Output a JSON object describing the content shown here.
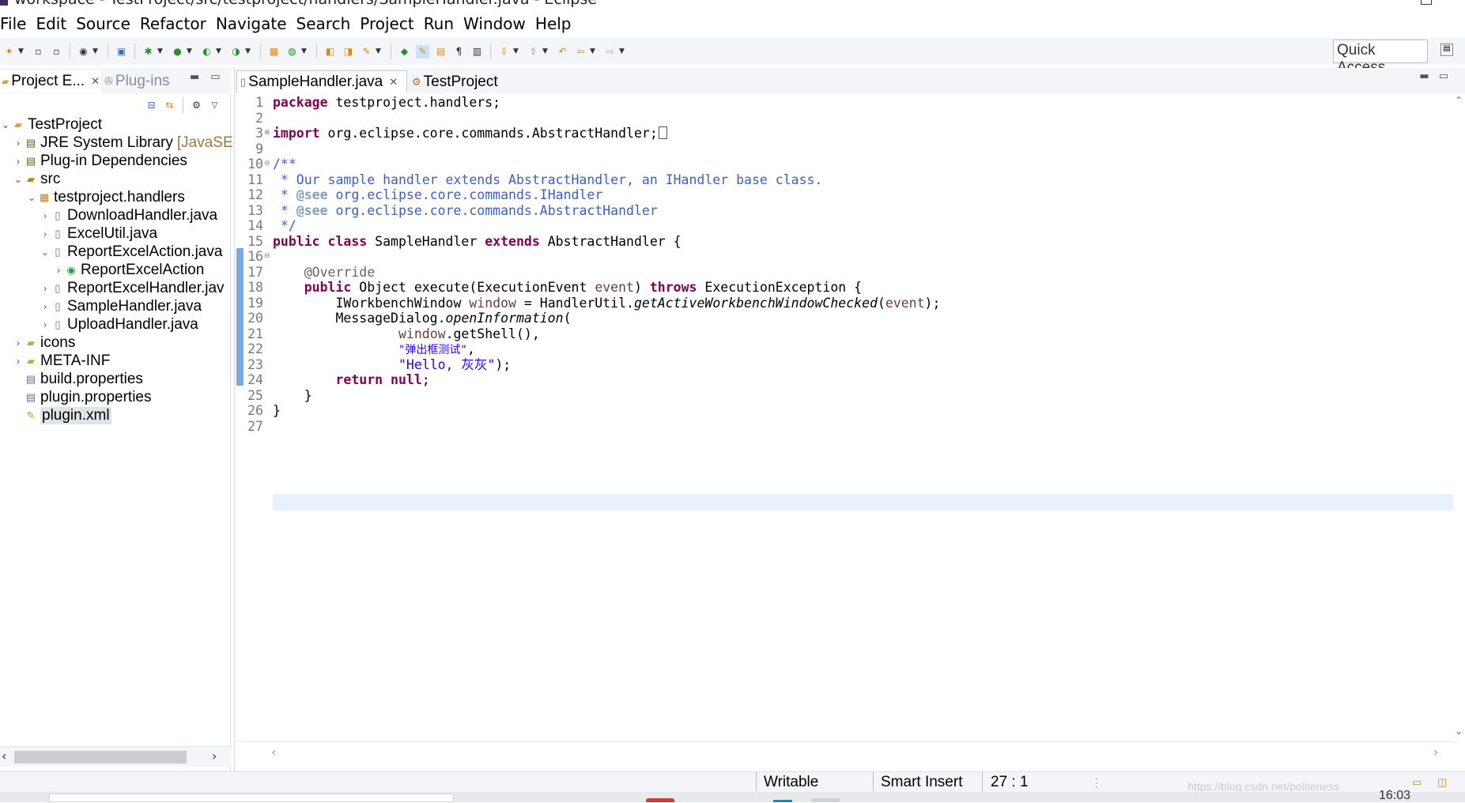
{
  "window": {
    "title": "workspace - TestProject/src/testproject/handlers/SampleHandler.java - Eclipse"
  },
  "menu": {
    "items": [
      "File",
      "Edit",
      "Source",
      "Refactor",
      "Navigate",
      "Search",
      "Project",
      "Run",
      "Window",
      "Help"
    ]
  },
  "toolbar": {
    "quick_access": "Quick Access"
  },
  "left_panel": {
    "tabs": [
      {
        "label": "Project E..."
      },
      {
        "label": "Plug-ins"
      }
    ],
    "tree": [
      {
        "label": "TestProject",
        "icon": "project-icon",
        "expanded": true
      },
      {
        "label": "JRE System Library",
        "decoration": "[JavaSE-",
        "icon": "library-icon"
      },
      {
        "label": "Plug-in Dependencies",
        "icon": "library-icon"
      },
      {
        "label": "src",
        "icon": "source-folder-icon",
        "expanded": true
      },
      {
        "label": "testproject.handlers",
        "icon": "package-icon",
        "expanded": true
      },
      {
        "label": "DownloadHandler.java",
        "icon": "java-file-icon"
      },
      {
        "label": "ExcelUtil.java",
        "icon": "java-file-icon"
      },
      {
        "label": "ReportExcelAction.java",
        "icon": "java-file-icon",
        "expanded": true
      },
      {
        "label": "ReportExcelAction",
        "icon": "class-icon"
      },
      {
        "label": "ReportExcelHandler.jav",
        "icon": "java-file-icon"
      },
      {
        "label": "SampleHandler.java",
        "icon": "java-file-icon"
      },
      {
        "label": "UploadHandler.java",
        "icon": "java-file-icon"
      },
      {
        "label": "icons",
        "icon": "folder-icon"
      },
      {
        "label": "META-INF",
        "icon": "folder-icon"
      },
      {
        "label": "build.properties",
        "icon": "properties-file-icon"
      },
      {
        "label": "plugin.properties",
        "icon": "properties-file-icon"
      },
      {
        "label": "plugin.xml",
        "icon": "xml-file-icon",
        "selected": true
      }
    ]
  },
  "editor": {
    "tabs": [
      {
        "label": "SampleHandler.java",
        "active": true
      },
      {
        "label": "TestProject"
      }
    ],
    "line_numbers": [
      "1",
      "2",
      "3",
      "9",
      "10",
      "11",
      "12",
      "13",
      "14",
      "15",
      "16",
      "17",
      "18",
      "19",
      "20",
      "21",
      "22",
      "23",
      "24",
      "25",
      "26",
      "27"
    ],
    "lines": {
      "l1_kw": "package",
      "l1_rest": " testproject.handlers;",
      "l3_kw": "import",
      "l3_rest": " org.eclipse.core.commands.AbstractHandler;",
      "l10": "/**",
      "l11": " * Our sample handler extends AbstractHandler, an IHandler base class.",
      "l12_a": " * ",
      "l12_tag": "@see",
      "l12_b": " org.eclipse.core.commands.IHandler",
      "l13_a": " * ",
      "l13_tag": "@see",
      "l13_b": " org.eclipse.core.commands.AbstractHandler",
      "l14": " */",
      "l15_kw1": "public",
      "l15_kw2": "class",
      "l15_name": " SampleHandler ",
      "l15_kw3": "extends",
      "l15_rest": " AbstractHandler {",
      "l17": "    @Override",
      "l18_kw1": "public",
      "l18_mid": " Object execute(ExecutionEvent ",
      "l18_param": "event",
      "l18_mid2": ") ",
      "l18_kw2": "throws",
      "l18_rest": " ExecutionException {",
      "l19_a": "        IWorkbenchWindow ",
      "l19_var": "window",
      "l19_b": " = HandlerUtil.",
      "l19_m": "getActiveWorkbenchWindowChecked",
      "l19_c": "(",
      "l19_p": "event",
      "l19_d": ");",
      "l20_a": "        MessageDialog.",
      "l20_m": "openInformation",
      "l20_b": "(",
      "l21_var": "window",
      "l21_rest": ".getShell(),",
      "l22_str": "\"弹出框测试\"",
      "l22_rest": ",",
      "l23_str": "\"Hello, 灰灰\"",
      "l23_rest": ");",
      "l24_kw1": "return",
      "l24_kw2": "null",
      "l24_rest": ";",
      "l25": "    }",
      "l26": "}"
    }
  },
  "status": {
    "writable": "Writable",
    "insert_mode": "Smart Insert",
    "position": "27 : 1",
    "watermark": "https://blog.csdn.net/politeness_",
    "clock": "16:03"
  }
}
